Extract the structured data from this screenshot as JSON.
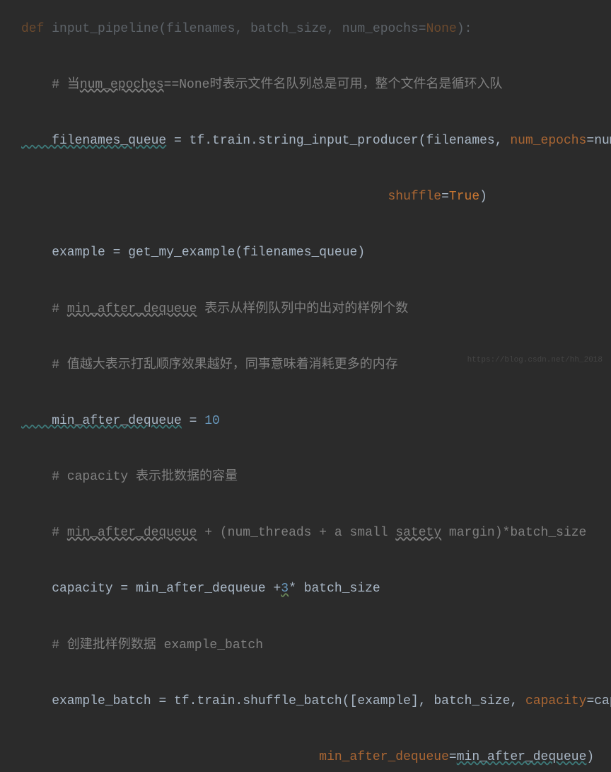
{
  "code": {
    "line0": {
      "prefix": "def",
      "func": "input_pipeline",
      "p1": "filenames",
      "p2": "batch_size",
      "p3": "num_epochs",
      "eq": "=",
      "none": "None",
      "end": "):"
    },
    "line1": {
      "comment_prefix": "    # 当",
      "typo": "num_epoches",
      "comment_suffix": "==None时表示文件名队列总是可用，整个文件名是循环入队"
    },
    "line2": {
      "var": "    filenames_queue",
      "eq": " = ",
      "module": "tf.train.",
      "func": "string_input_producer",
      "open": "(",
      "arg1": "filenames",
      "comma1": ", ",
      "param1": "num_epochs",
      "eq1": "=",
      "val1": "num_epochs",
      "comma2": ","
    },
    "line3": {
      "pad": "                                                ",
      "param": "shuffle",
      "eq": "=",
      "val": "True",
      "close": ")"
    },
    "line4": {
      "var": "    example",
      "eq": " = ",
      "func": "get_my_example",
      "open": "(",
      "arg": "filenames_queue",
      "close": ")"
    },
    "line5": {
      "comment_prefix": "    # ",
      "typo": "min_after_dequeue",
      "comment_suffix": " 表示从样例队列中的出对的样例个数"
    },
    "line6": {
      "comment": "    # 值越大表示打乱顺序效果越好，同事意味着消耗更多的内存"
    },
    "line7": {
      "var": "    min_after_dequeue",
      "eq": " = ",
      "num": "10"
    },
    "line8": {
      "comment": "    # capacity 表示批数据的容量"
    },
    "line9": {
      "comment_prefix": "    # ",
      "typo1": "min_after_dequeue",
      "comment_mid": " + (num_threads + a small ",
      "typo2": "satety",
      "comment_suffix": " margin)*batch_size"
    },
    "line10": {
      "var": "    capacity",
      "eq": " = ",
      "var2": "min_after_dequeue ",
      "op": "+",
      "num": "3",
      "op2": "*",
      "var3": " batch_size"
    },
    "line11": {
      "comment": "    # 创建批样例数据 example_batch"
    },
    "line12": {
      "var": "    example_batch",
      "eq": " = ",
      "module": "tf.train.",
      "func": "shuffle_batch",
      "open": "(",
      "bracket_open": "[",
      "arg1": "example",
      "bracket_close": "]",
      "comma1": ", ",
      "arg2": "batch_size",
      "comma2": ", ",
      "param1": "capacity",
      "eq1": "=",
      "val1": "capacity",
      "comma3": ","
    },
    "line13": {
      "pad": "                                       ",
      "param": "min_after_dequeue",
      "eq": "=",
      "val": "min_after_dequeue",
      "close": ")"
    }
  },
  "watermark": "https://blog.csdn.net/hh_2018"
}
